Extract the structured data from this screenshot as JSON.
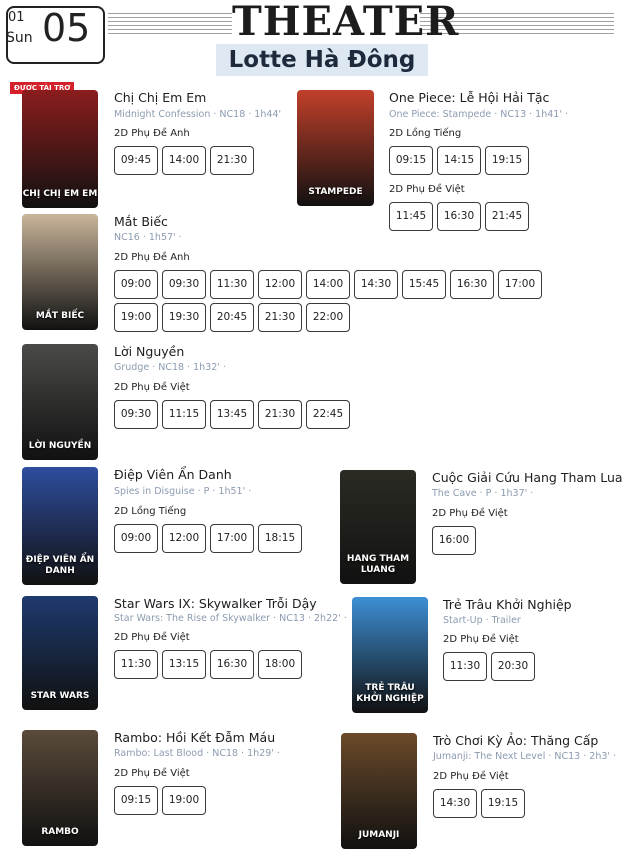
{
  "header": {
    "month": "01",
    "weekday": "Sun",
    "day": "05",
    "title": "THEATER",
    "cinema": "Lotte Hà Đông"
  },
  "sponsor_badge": "ĐƯỢC TÀI TRỢ",
  "movies": [
    {
      "title": "Chị Chị Em Em",
      "subtitle": "Midnight Confession · NC18 · 1h44'",
      "format": "2D Phụ Đề Anh",
      "times": [
        "09:45",
        "14:00",
        "21:30"
      ],
      "poster_text": "CHỊ CHỊ EM EM",
      "poster_color": "#8b1d1d"
    },
    {
      "title": "One Piece: Lễ Hội Hải Tặc",
      "subtitle": "One Piece: Stampede · NC13 · 1h41' ·",
      "formats": [
        {
          "format": "2D Lồng Tiếng",
          "times": [
            "09:15",
            "14:15",
            "19:15"
          ]
        },
        {
          "format": "2D Phụ Đề Việt",
          "times": [
            "11:45",
            "16:30",
            "21:45"
          ]
        }
      ],
      "poster_text": "STAMPEDE",
      "poster_color": "#c2402a"
    },
    {
      "title": "Mắt Biếc",
      "subtitle": "NC16 · 1h57' ·",
      "format": "2D Phụ Đề Anh",
      "times": [
        "09:00",
        "09:30",
        "11:30",
        "12:00",
        "14:00",
        "14:30",
        "15:45",
        "16:30",
        "17:00",
        "19:00",
        "19:30",
        "20:45",
        "21:30",
        "22:00"
      ],
      "poster_text": "MẮT BIẾC",
      "poster_color": "#c9b59a"
    },
    {
      "title": "Lời Nguyền",
      "subtitle": "Grudge · NC18 · 1h32' ·",
      "format": "2D Phụ Đề Việt",
      "times": [
        "09:30",
        "11:15",
        "13:45",
        "21:30",
        "22:45"
      ],
      "poster_text": "LỜI NGUYỀN",
      "poster_color": "#4a4a48"
    },
    {
      "title": "Điệp Viên Ẩn Danh",
      "subtitle": "Spies in Disguise · P · 1h51' ·",
      "format": "2D Lồng Tiếng",
      "times": [
        "09:00",
        "12:00",
        "17:00",
        "18:15"
      ],
      "poster_text": "ĐIỆP VIÊN ẨN DANH",
      "poster_color": "#2e4d9e"
    },
    {
      "title": "Cuộc Giải Cứu Hang Tham Luang",
      "subtitle": "The Cave · P · 1h37' ·",
      "format": "2D Phụ Đề Việt",
      "times": [
        "16:00"
      ],
      "poster_text": "HANG THAM LUANG",
      "poster_color": "#2b2b24"
    },
    {
      "title": "Star Wars IX: Skywalker Trỗi Dậy",
      "subtitle": "Star Wars: The Rise of Skywalker · NC13 · 2h22' ·",
      "format": "2D Phụ Đề Việt",
      "times": [
        "11:30",
        "13:15",
        "16:30",
        "18:00"
      ],
      "poster_text": "STAR WARS",
      "poster_color": "#1e3a6e"
    },
    {
      "title": "Trẻ Trâu Khởi Nghiệp",
      "subtitle": "Start-Up · Trailer",
      "format": "2D Phụ Đề Việt",
      "times": [
        "11:30",
        "20:30"
      ],
      "poster_text": "TRẺ TRÂU KHỞI NGHIỆP",
      "poster_color": "#3d8fd4"
    },
    {
      "title": "Rambo: Hồi Kết Đẫm Máu",
      "subtitle": "Rambo: Last Blood · NC18 · 1h29' ·",
      "format": "2D Phụ Đề Việt",
      "times": [
        "09:15",
        "19:00"
      ],
      "poster_text": "RAMBO",
      "poster_color": "#5a4a3a"
    },
    {
      "title": "Trò Chơi Kỳ Ảo: Thăng Cấp",
      "subtitle": "Jumanji: The Next Level · NC13 · 2h3' ·",
      "format": "2D Phụ Đề Việt",
      "times": [
        "14:30",
        "19:15"
      ],
      "poster_text": "JUMANJI",
      "poster_color": "#6b4a2a"
    }
  ],
  "colors": {
    "accent_blue": "#dde8f3",
    "badge_red": "#d3202a",
    "subtitle_gray": "#8c9bb0"
  }
}
